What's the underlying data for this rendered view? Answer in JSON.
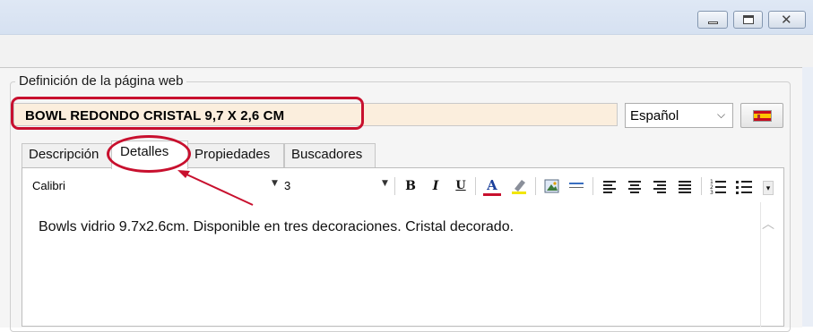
{
  "window": {
    "minimize_label": "minimize",
    "maximize_label": "maximize",
    "close_glyph": "✕"
  },
  "group": {
    "label": "Definición de la página web"
  },
  "product": {
    "title": "BOWL REDONDO CRISTAL 9,7 X 2,6 CM"
  },
  "language": {
    "selected": "Español",
    "flag": "spain-flag-icon"
  },
  "tabs": [
    {
      "label": "Descripción",
      "active": false
    },
    {
      "label": "Detalles",
      "active": true
    },
    {
      "label": "Propiedades",
      "active": false
    },
    {
      "label": "Buscadores",
      "active": false
    }
  ],
  "editor": {
    "font": "Calibri",
    "size": "3",
    "toolbar": {
      "bold": "B",
      "italic": "I",
      "underline": "U",
      "font_color": "A",
      "more": "▾"
    },
    "content": "Bowls vidrio 9.7x2.6cm. Disponible en tres decoraciones. Cristal decorado."
  },
  "annotations": {
    "highlight_color": "#c8102e"
  },
  "colors": {
    "title_bg": "#fbeedd",
    "accent_red": "#c8102e"
  }
}
